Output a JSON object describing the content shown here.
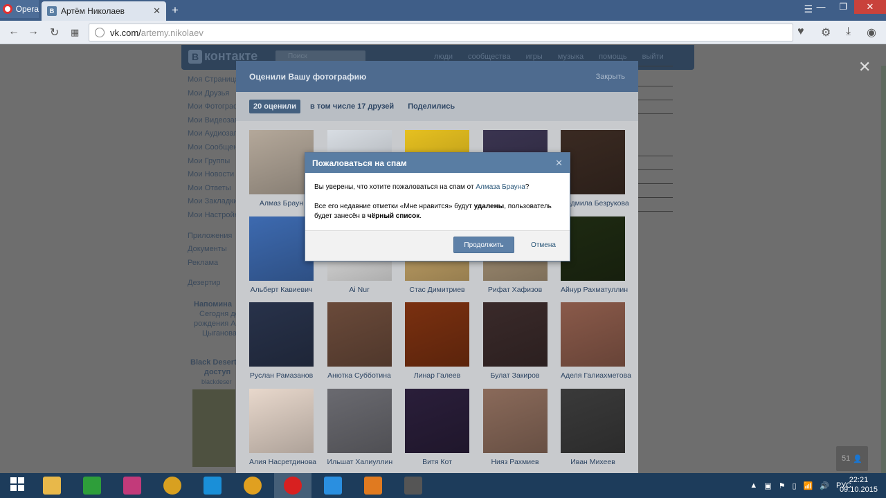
{
  "browser": {
    "menu_label": "Opera",
    "tab_favicon": "B",
    "tab_title": "Артём Николаев",
    "url_host": "vk.com/",
    "url_path": "artemy.nikolaev"
  },
  "vk": {
    "logo_text": "контакте",
    "search_placeholder": "Поиск",
    "nav": [
      "люди",
      "сообщества",
      "игры",
      "музыка",
      "помощь",
      "выйти"
    ],
    "left_menu": [
      "Моя Страница",
      "Мои Друзья",
      "Мои Фотографии",
      "Мои Видеозаписи",
      "Мои Аудиозаписи",
      "Мои Сообщения",
      "Мои Группы",
      "Мои Новости",
      "Мои Ответы",
      "Мои Закладки",
      "Мои Настройки",
      "Приложения",
      "Документы",
      "Реклама",
      "Дезертир"
    ],
    "remind_title": "Напомина",
    "remind_lines": [
      "Сегодня де",
      "рождения А",
      "Цыганова"
    ],
    "bd_title": "Black Desert",
    "bd_lines": [
      "доступ",
      "blackdeser"
    ]
  },
  "likes_modal": {
    "title": "Оценили Вашу фотографию",
    "close": "Закрыть",
    "tab_active": "20 оценили",
    "tab_friends": "в том числе 17 друзей",
    "tab_shared": "Поделились",
    "people": [
      {
        "name": "Алмаз Браун",
        "color": "#b4a89a"
      },
      {
        "name": "",
        "color": "#d8dde3"
      },
      {
        "name": "",
        "color": "#e6c020"
      },
      {
        "name": "",
        "color": "#3a3450"
      },
      {
        "name": "Людмила Безрукова",
        "color": "#3a2a22"
      },
      {
        "name": "Альберт Кавиевич",
        "color": "#3d6ab0"
      },
      {
        "name": "Ai Nur",
        "color": "#e8e8e8"
      },
      {
        "name": "Стас Димитриев",
        "color": "#c9a86a"
      },
      {
        "name": "Рифат Хафизов",
        "color": "#a89478"
      },
      {
        "name": "Айнур Рахматуллин",
        "color": "#1e2a12"
      },
      {
        "name": "Руслан Рамазанов",
        "color": "#28324a"
      },
      {
        "name": "Анютка Субботина",
        "color": "#6a4a3a"
      },
      {
        "name": "Линар Галеев",
        "color": "#7a3010"
      },
      {
        "name": "Булат Закиров",
        "color": "#3a2a2a"
      },
      {
        "name": "Аделя Галиахметова",
        "color": "#8a5a4a"
      },
      {
        "name": "Алия Насретдинова",
        "color": "#e8d8cc"
      },
      {
        "name": "Ильшат Халиуллин",
        "color": "#6a6a70"
      },
      {
        "name": "Витя Кот",
        "color": "#2a1e3a"
      },
      {
        "name": "Нияз Рахмиев",
        "color": "#8a6a5a"
      },
      {
        "name": "Иван Михеев",
        "color": "#3a3a3a"
      }
    ]
  },
  "spam_dialog": {
    "title": "Пожаловаться на спам",
    "q_prefix": "Вы уверены, что хотите пожаловаться на спам от ",
    "q_user": "Алмаза Брауна",
    "q_suffix": "?",
    "l1_a": "Все его недавние отметки «Мне нравится» будут ",
    "l1_b": "удалены",
    "l1_c": ", пользователь",
    "l2_a": "будет занесён в ",
    "l2_b": "чёрный список",
    "l2_c": ".",
    "confirm": "Продолжить",
    "cancel": "Отмена"
  },
  "notify_count": "51",
  "tray": {
    "lang": "РУС",
    "time": "22:21",
    "date": "09.10.2015"
  },
  "taskbar": [
    {
      "icon": "windows-start-icon",
      "color": "#ffffff"
    },
    {
      "icon": "file-explorer-icon",
      "color": "#e8b84a"
    },
    {
      "icon": "store-icon",
      "color": "#2e9e3a"
    },
    {
      "icon": "photo-app-icon",
      "color": "#c23a7a"
    },
    {
      "icon": "media-player-icon",
      "color": "#d8a020"
    },
    {
      "icon": "hp-icon",
      "color": "#1a8fd8"
    },
    {
      "icon": "chrome-icon",
      "color": "#e0a020"
    },
    {
      "icon": "opera-icon",
      "color": "#d82020"
    },
    {
      "icon": "internet-explorer-icon",
      "color": "#2a8fe0"
    },
    {
      "icon": "video-app-icon",
      "color": "#e07a20"
    },
    {
      "icon": "screen-recorder-icon",
      "color": "#555555"
    }
  ]
}
